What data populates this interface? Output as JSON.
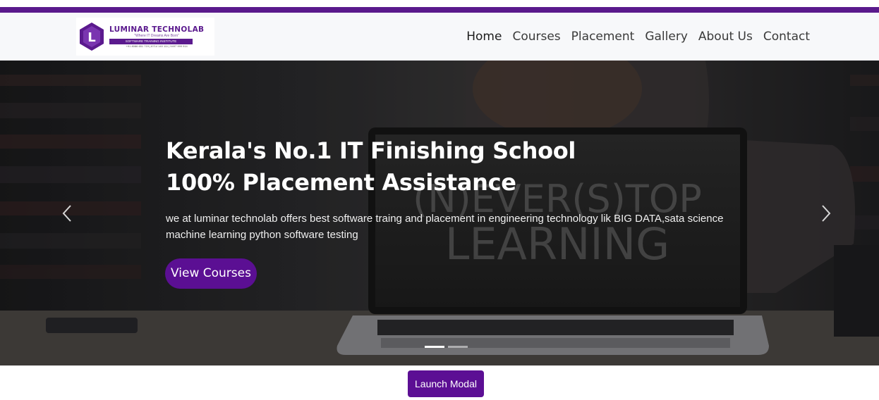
{
  "brand": {
    "name": "LUMINAR TECHNOLAB",
    "logo_letter": "L",
    "tagline": "\"Where IT Dreams Are Born\"",
    "strip": "SOFTWARE TRAINING INSTITUTE",
    "contact": "+91 8086 651 719 | 8714 140 111 | 9497 999 914"
  },
  "nav": {
    "items": [
      "Home",
      "Courses",
      "Placement",
      "Gallery",
      "About Us",
      "Contact"
    ],
    "active": "Home"
  },
  "hero": {
    "title_line1": "Kerala's No.1 IT Finishing School",
    "title_line2": "100% Placement Assistance",
    "description": "we at luminar technolab offers best software traing and placement in engineering technology lik BIG DATA,sata science machine learning python software testing",
    "cta_label": "View Courses",
    "background_text": "(N)EVER(S)TOP LEARNING",
    "slides_total": 2,
    "active_slide": 1,
    "prev_icon": "chevron-left-icon",
    "next_icon": "chevron-right-icon"
  },
  "modal_button": {
    "label": "Launch Modal"
  },
  "colors": {
    "accent": "#5b0f93",
    "top_bar": "#5a1a8c",
    "navbar_bg": "#f7f8fa",
    "nav_text": "#3a3a3a"
  }
}
